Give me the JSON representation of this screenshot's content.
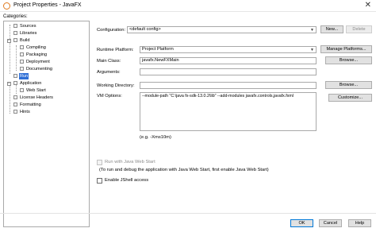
{
  "window": {
    "title": "Project Properties - JavaFX",
    "close_glyph": "✕"
  },
  "categories_label": "Categories:",
  "tree": [
    {
      "label": "Sources",
      "level": 1,
      "toggle": ""
    },
    {
      "label": "Libraries",
      "level": 1,
      "toggle": ""
    },
    {
      "label": "Build",
      "level": 0,
      "toggle": "−"
    },
    {
      "label": "Compiling",
      "level": 2,
      "toggle": ""
    },
    {
      "label": "Packaging",
      "level": 2,
      "toggle": ""
    },
    {
      "label": "Deployment",
      "level": 2,
      "toggle": ""
    },
    {
      "label": "Documenting",
      "level": 2,
      "toggle": ""
    },
    {
      "label": "Run",
      "level": 1,
      "toggle": "",
      "selected": true
    },
    {
      "label": "Application",
      "level": 0,
      "toggle": "−"
    },
    {
      "label": "Web Start",
      "level": 2,
      "toggle": ""
    },
    {
      "label": "License Headers",
      "level": 1,
      "toggle": ""
    },
    {
      "label": "Formatting",
      "level": 1,
      "toggle": ""
    },
    {
      "label": "Hints",
      "level": 1,
      "toggle": ""
    }
  ],
  "form": {
    "configuration_label": "Configuration:",
    "configuration_value": "<default config>",
    "new_button": "New...",
    "delete_button": "Delete",
    "runtime_platform_label": "Runtime Platform:",
    "runtime_platform_value": "Project Platform",
    "manage_platforms_button": "Manage Platforms...",
    "main_class_label": "Main Class:",
    "main_class_value": "javafx.NewFXMain",
    "browse_button": "Browse...",
    "arguments_label": "Arguments:",
    "arguments_value": "",
    "working_directory_label": "Working Directory:",
    "working_directory_value": "",
    "browse_button_2": "Browse...",
    "vm_options_label": "VM Options:",
    "vm_options_value": "--module-path \"C:\\java fx-sdk-13.0.2\\lib\" --add-modules javafx.controls,javafx.fxml",
    "customize_button": "Customize...",
    "vm_hint": "(e.g. -Xms10m)",
    "web_start_checkbox": "Run with Java Web Start",
    "web_start_note": "(To run and debug the application with Java Web Start, first enable Java Web Start)",
    "jshell_checkbox": "Enable JShell access"
  },
  "footer": {
    "ok_button": "OK",
    "cancel_button": "Cancel",
    "help_button": "Help"
  },
  "colors": {
    "selection": "#2f6fd6",
    "accent": "#0078d7"
  }
}
